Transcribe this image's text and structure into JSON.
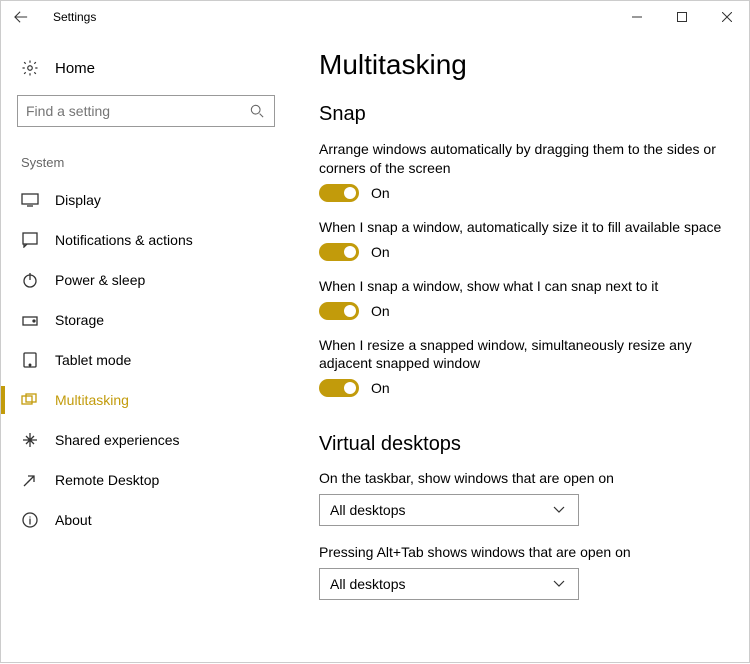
{
  "titlebar": {
    "title": "Settings"
  },
  "sidebar": {
    "home": "Home",
    "search_placeholder": "Find a setting",
    "group_header": "System",
    "items": [
      {
        "label": "Display"
      },
      {
        "label": "Notifications & actions"
      },
      {
        "label": "Power & sleep"
      },
      {
        "label": "Storage"
      },
      {
        "label": "Tablet mode"
      },
      {
        "label": "Multitasking"
      },
      {
        "label": "Shared experiences"
      },
      {
        "label": "Remote Desktop"
      },
      {
        "label": "About"
      }
    ]
  },
  "page": {
    "title": "Multitasking",
    "snap": {
      "heading": "Snap",
      "s1": {
        "desc": "Arrange windows automatically by dragging them to the sides or corners of the screen",
        "state": "On"
      },
      "s2": {
        "desc": "When I snap a window, automatically size it to fill available space",
        "state": "On"
      },
      "s3": {
        "desc": "When I snap a window, show what I can snap next to it",
        "state": "On"
      },
      "s4": {
        "desc": "When I resize a snapped window, simultaneously resize any adjacent snapped window",
        "state": "On"
      }
    },
    "vd": {
      "heading": "Virtual desktops",
      "d1": {
        "label": "On the taskbar, show windows that are open on",
        "value": "All desktops"
      },
      "d2": {
        "label": "Pressing Alt+Tab shows windows that are open on",
        "value": "All desktops"
      }
    }
  }
}
